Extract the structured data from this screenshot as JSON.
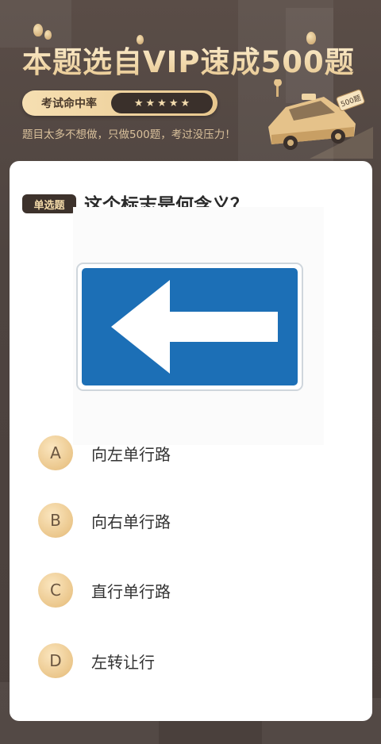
{
  "header": {
    "title": "本题选自VIP速成500题",
    "pill_label": "考试命中率",
    "stars": [
      "★",
      "★",
      "★",
      "★",
      "★"
    ],
    "subtitle": "题目太多不想做，只做500题，考过没压力！",
    "car_badge": "500题"
  },
  "question": {
    "type_tag": "单选题",
    "text": "这个标志是何含义？",
    "sign": {
      "background_color": "#1c6fb6",
      "arrow_color": "#ffffff",
      "arrow_direction": "left"
    }
  },
  "options": [
    {
      "letter": "A",
      "text": "向左单行路"
    },
    {
      "letter": "B",
      "text": "向右单行路"
    },
    {
      "letter": "C",
      "text": "直行单行路"
    },
    {
      "letter": "D",
      "text": "左转让行"
    }
  ],
  "colors": {
    "accent_gold": "#e9c88e",
    "dark_brown": "#3d322c",
    "text_dark": "#2a2a2a"
  }
}
